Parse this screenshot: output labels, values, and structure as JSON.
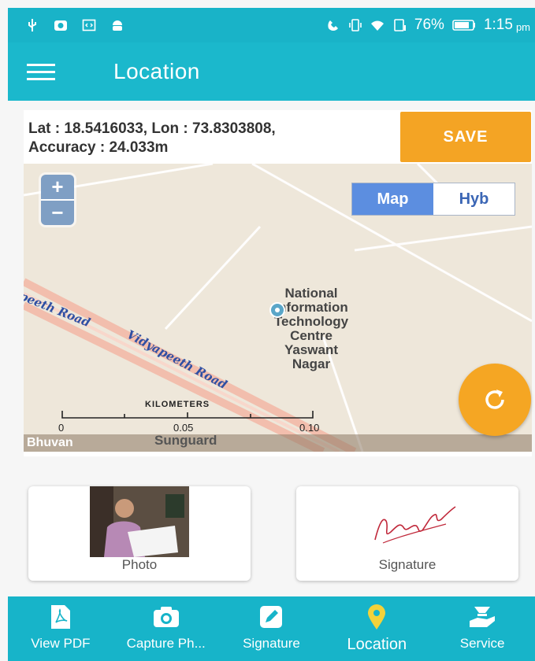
{
  "status_bar": {
    "battery": "76%",
    "time": "1:15",
    "ampm": "pm",
    "icons": [
      "usb-icon",
      "app-icon",
      "code-icon",
      "android-icon",
      "missed-call-icon",
      "vibrate-icon",
      "wifi-icon",
      "sim-icon",
      "battery-icon"
    ]
  },
  "app_bar": {
    "title": "Location",
    "menu_icon": "hamburger-menu-icon"
  },
  "location": {
    "coords_line1": "Lat : 18.5416033, Lon : 73.8303808,",
    "coords_line2": "Accuracy : 24.033m",
    "save_label": "SAVE"
  },
  "map": {
    "zoom_in": "+",
    "zoom_out": "−",
    "type_map": "Map",
    "type_hyb": "Hyb",
    "place_line1": "National",
    "place_line2": "Information",
    "place_line3": "Technology",
    "place_line4": "Centre",
    "place_line5": "Yaswant",
    "place_line6": "Nagar",
    "road_label_1": "peeth Road",
    "road_label_2": "Vidyapeeth Road",
    "scale_title": "KILOMETERS",
    "scale_0": "0",
    "scale_1": "0.05",
    "scale_2": "0.10",
    "brand": "Bhuvan",
    "bottom_road": "Sunguard"
  },
  "cards": {
    "photo_label": "Photo",
    "signature_label": "Signature"
  },
  "bottom_nav": {
    "items": [
      {
        "label": "View PDF",
        "icon": "pdf-icon"
      },
      {
        "label": "Capture Ph...",
        "icon": "camera-icon"
      },
      {
        "label": "Signature",
        "icon": "pencil-icon"
      },
      {
        "label": "Location",
        "icon": "location-pin-icon"
      },
      {
        "label": "Service",
        "icon": "service-hand-icon"
      }
    ],
    "active_index": 3
  },
  "colors": {
    "primary": "#1bb8cc",
    "accent": "#f4a424",
    "map_bg": "#eee7da",
    "map_button": "#5c8ee0",
    "location_pin": "#f3d23a"
  }
}
